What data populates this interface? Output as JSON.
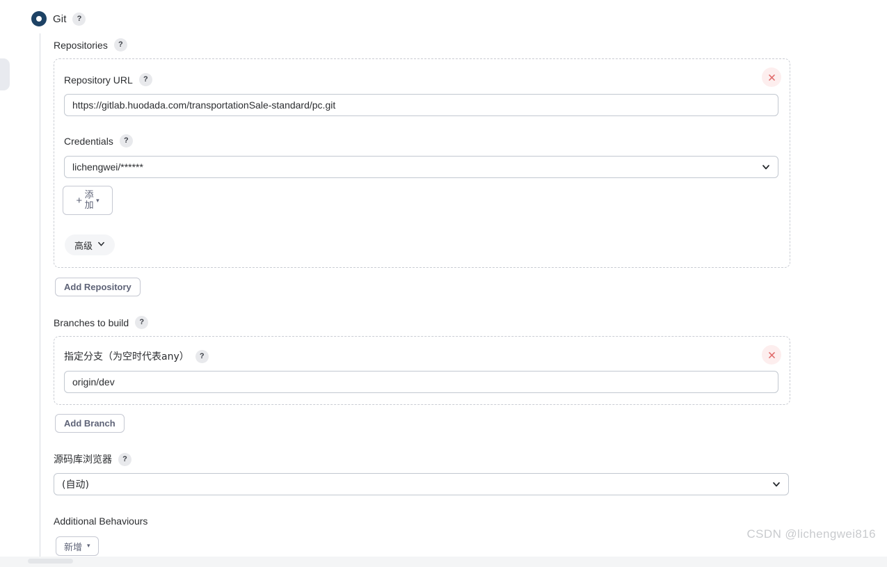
{
  "scm": {
    "selected_label": "Git",
    "help_icon": "help-icon",
    "radio_color": "#1d4265"
  },
  "repositories": {
    "section_label": "Repositories",
    "url_field": {
      "label": "Repository URL",
      "value": "https://gitlab.huodada.com/transportationSale-standard/pc.git"
    },
    "credentials_field": {
      "label": "Credentials",
      "value": "lichengwei/******"
    },
    "add_credentials_button": {
      "plus": "+",
      "line1": "添",
      "line2": "加",
      "caret": "▾"
    },
    "advanced_button": {
      "label": "高级",
      "caret_icon": "chevron-down-icon"
    },
    "remove_button": {
      "icon": "close-icon",
      "color": "#e06c6c"
    },
    "add_repository_button": "Add Repository"
  },
  "branches": {
    "section_label": "Branches to build",
    "branch_field": {
      "label": "指定分支（为空时代表any）",
      "value": "origin/dev"
    },
    "remove_button": {
      "icon": "close-icon",
      "color": "#e06c6c"
    },
    "add_branch_button": "Add Branch"
  },
  "repository_browser": {
    "label": "源码库浏览器",
    "value": "(自动)"
  },
  "additional_behaviours": {
    "label": "Additional Behaviours",
    "add_button": {
      "label": "新增",
      "caret": "▾"
    }
  },
  "watermark": "CSDN @lichengwei816"
}
